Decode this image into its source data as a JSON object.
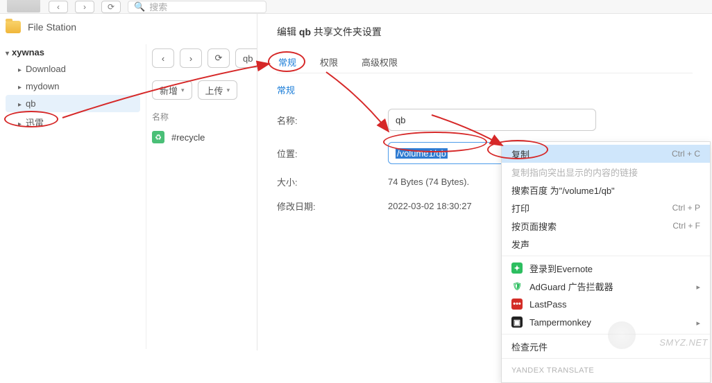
{
  "topbar": {
    "search_placeholder": "搜索"
  },
  "app_title": "File Station",
  "sidebar": {
    "root": "xywnas",
    "items": [
      {
        "label": "Download"
      },
      {
        "label": "mydown"
      },
      {
        "label": "qb"
      },
      {
        "label": "迅雷"
      }
    ]
  },
  "main": {
    "path": "qb",
    "new_btn": "新增",
    "upload_btn": "上传",
    "column_name": "名称",
    "rows": [
      {
        "name": "#recycle"
      }
    ]
  },
  "dialog": {
    "title_prefix": "编辑",
    "title_name": "qb",
    "title_suffix": "共享文件夹设置",
    "tabs": {
      "general": "常规",
      "perm": "权限",
      "adv": "高级权限"
    },
    "section": "常规",
    "labels": {
      "name": "名称:",
      "location": "位置:",
      "size": "大小:",
      "mtime": "修改日期:"
    },
    "values": {
      "name": "qb",
      "location": "/volume1/qb",
      "size": "74 Bytes (74 Bytes).",
      "mtime": "2022-03-02 18:30:27"
    }
  },
  "context_menu": {
    "copy": "复制",
    "copy_link": "复制指向突出显示的内容的链接",
    "search_baidu": "搜索百度 为\"/volume1/qb\"",
    "print": "打印",
    "page_search": "按页面搜索",
    "speak": "发声",
    "evernote": "登录到Evernote",
    "adguard": "AdGuard 广告拦截器",
    "lastpass": "LastPass",
    "tampermonkey": "Tampermonkey",
    "inspect": "检查元件",
    "yandex": "YANDEX TRANSLATE",
    "shortcuts": {
      "copy": "Ctrl + C",
      "print": "Ctrl + P",
      "page_search": "Ctrl + F"
    }
  },
  "watermark": "SMYZ.NET"
}
